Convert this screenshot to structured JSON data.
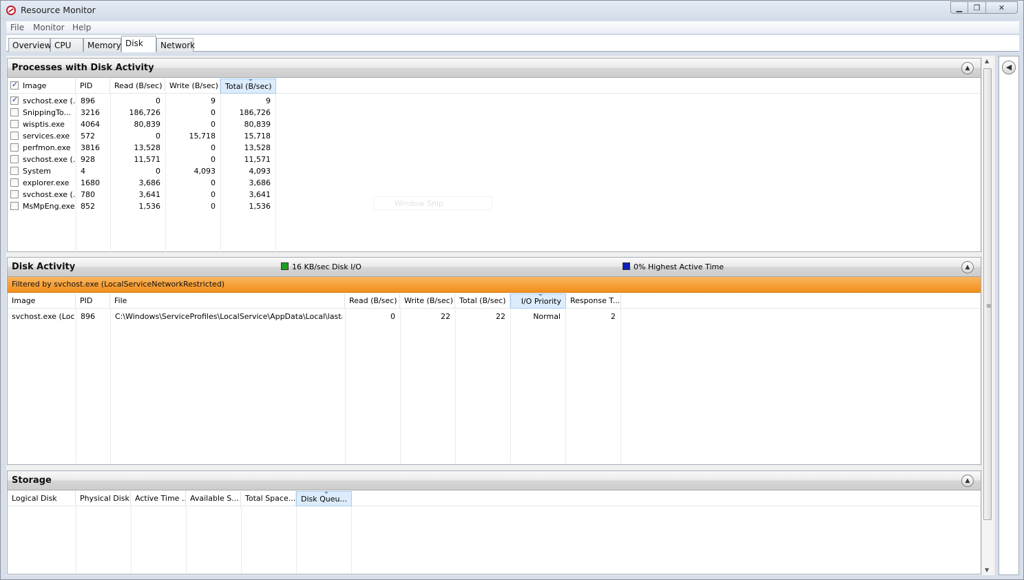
{
  "window": {
    "title": "Resource Monitor"
  },
  "menu": [
    "File",
    "Monitor",
    "Help"
  ],
  "tabs": [
    "Overview",
    "CPU",
    "Memory",
    "Disk",
    "Network"
  ],
  "processes": {
    "title": "Processes with Disk Activity",
    "columns": [
      "Image",
      "PID",
      "Read (B/sec)",
      "Write (B/sec)",
      "Total (B/sec)"
    ],
    "rows": [
      {
        "checked": true,
        "image": "svchost.exe (...",
        "pid": "896",
        "read": "0",
        "write": "9",
        "total": "9"
      },
      {
        "checked": false,
        "image": "SnippingTo...",
        "pid": "3216",
        "read": "186,726",
        "write": "0",
        "total": "186,726"
      },
      {
        "checked": false,
        "image": "wisptis.exe",
        "pid": "4064",
        "read": "80,839",
        "write": "0",
        "total": "80,839"
      },
      {
        "checked": false,
        "image": "services.exe",
        "pid": "572",
        "read": "0",
        "write": "15,718",
        "total": "15,718"
      },
      {
        "checked": false,
        "image": "perfmon.exe",
        "pid": "3816",
        "read": "13,528",
        "write": "0",
        "total": "13,528"
      },
      {
        "checked": false,
        "image": "svchost.exe (...",
        "pid": "928",
        "read": "11,571",
        "write": "0",
        "total": "11,571"
      },
      {
        "checked": false,
        "image": "System",
        "pid": "4",
        "read": "0",
        "write": "4,093",
        "total": "4,093"
      },
      {
        "checked": false,
        "image": "explorer.exe",
        "pid": "1680",
        "read": "3,686",
        "write": "0",
        "total": "3,686"
      },
      {
        "checked": false,
        "image": "svchost.exe (...",
        "pid": "780",
        "read": "3,641",
        "write": "0",
        "total": "3,641"
      },
      {
        "checked": false,
        "image": "MsMpEng.exe",
        "pid": "852",
        "read": "1,536",
        "write": "0",
        "total": "1,536"
      }
    ],
    "ghost_text": "Window Snip"
  },
  "disk_activity": {
    "title": "Disk Activity",
    "legend_io": "16 KB/sec Disk I/O",
    "legend_active": "0% Highest Active Time",
    "io_color": "#1ea01e",
    "active_color": "#1020b8",
    "filter": "Filtered by svchost.exe (LocalServiceNetworkRestricted)",
    "columns": [
      "Image",
      "PID",
      "File",
      "Read (B/sec)",
      "Write (B/sec)",
      "Total (B/sec)",
      "I/O Priority",
      "Response T..."
    ],
    "rows": [
      {
        "image": "svchost.exe (Loc...",
        "pid": "896",
        "file": "C:\\Windows\\ServiceProfiles\\LocalService\\AppData\\Local\\lastali...",
        "read": "0",
        "write": "22",
        "total": "22",
        "priority": "Normal",
        "response": "2"
      }
    ]
  },
  "storage": {
    "title": "Storage",
    "columns": [
      "Logical Disk",
      "Physical Disk",
      "Active Time ...",
      "Available S...",
      "Total Space...",
      "Disk Queu..."
    ]
  }
}
